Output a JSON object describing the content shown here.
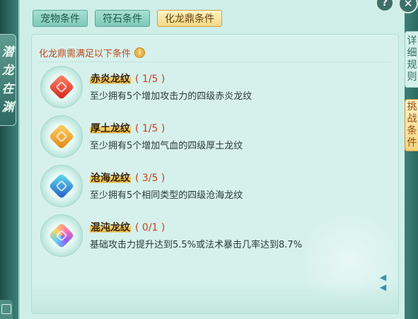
{
  "left_banner": {
    "chars": [
      "潜",
      "龙",
      "在",
      "渊"
    ]
  },
  "tabs": [
    {
      "label": "宠物条件",
      "active": false
    },
    {
      "label": "符石条件",
      "active": false
    },
    {
      "label": "化龙鼎条件",
      "active": true
    }
  ],
  "header": {
    "title": "化龙鼎需满足以下条件",
    "info_icon": "info-icon"
  },
  "items": [
    {
      "name": "赤炎龙纹",
      "count": "( 1/5 )",
      "desc": "至少拥有5个增加攻击力的四级赤炎龙纹",
      "icon": "red-gem-icon",
      "color": "#e2382b"
    },
    {
      "name": "厚土龙纹",
      "count": "( 1/5 )",
      "desc": "至少拥有5个增加气血的四级厚土龙纹",
      "icon": "gold-gem-icon",
      "color": "#f0a223"
    },
    {
      "name": "沧海龙纹",
      "count": "( 3/5 )",
      "desc": "至少拥有5个相同类型的四级沧海龙纹",
      "icon": "blue-gem-icon",
      "color": "#2d8fd9"
    },
    {
      "name": "混沌龙纹",
      "count": "( 0/1 )",
      "desc": "基础攻击力提升达到5.5%或法术暴击几率达到8.7%",
      "icon": "chaos-gem-icon",
      "color": "#a45cd6"
    }
  ],
  "side_tabs": [
    {
      "chars": [
        "详",
        "细",
        "规",
        "则"
      ],
      "active": false
    },
    {
      "chars": [
        "挑",
        "战",
        "条",
        "件"
      ],
      "active": true
    }
  ],
  "buttons": {
    "help": "?",
    "close": "✕"
  }
}
